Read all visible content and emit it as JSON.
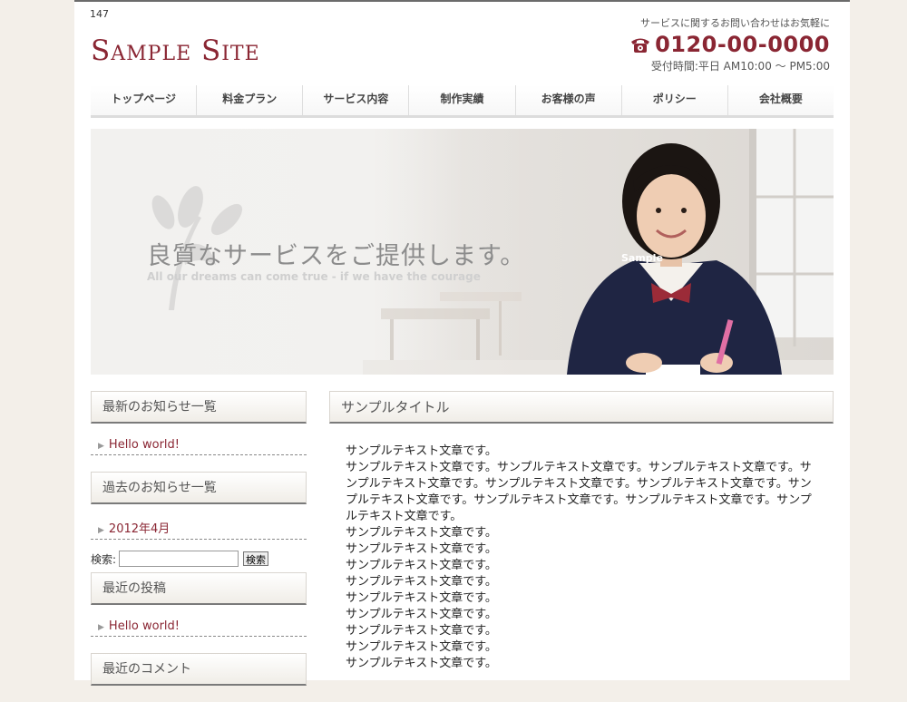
{
  "page_id": "147",
  "site": {
    "logo": "Sample Site"
  },
  "contact": {
    "note": "サービスに関するお問い合わせはお気軽に",
    "phone": "0120-00-0000",
    "hours": "受付時間:平日 AM10:00 〜 PM5:00",
    "icon": "phone-icon"
  },
  "nav": {
    "items": [
      "トップページ",
      "料金プラン",
      "サービス内容",
      "制作実績",
      "お客様の声",
      "ポリシー",
      "会社概要"
    ]
  },
  "hero": {
    "headline": "良質なサービスをご提供します。",
    "subline": "All our dreams can come true - if we have the courage",
    "watermark": "Sample"
  },
  "sidebar": {
    "news_title": "最新のお知らせ一覧",
    "news_items": [
      "Hello world!"
    ],
    "archive_title": "過去のお知らせ一覧",
    "archive_items": [
      "2012年4月"
    ],
    "search_label": "検索:",
    "search_value": "",
    "search_button": "検索",
    "recent_posts_title": "最近の投稿",
    "recent_posts": [
      "Hello world!"
    ],
    "recent_comments_title": "最近のコメント"
  },
  "main": {
    "title": "サンプルタイトル",
    "lines": [
      "サンプルテキスト文章です。",
      "サンプルテキスト文章です。サンプルテキスト文章です。サンプルテキスト文章です。サ",
      "ンプルテキスト文章です。サンプルテキスト文章です。サンプルテキスト文章です。サン",
      "プルテキスト文章です。サンプルテキスト文章です。サンプルテキスト文章です。サンプ",
      "ルテキスト文章です。",
      "サンプルテキスト文章です。",
      "サンプルテキスト文章です。",
      "サンプルテキスト文章です。",
      "サンプルテキスト文章です。",
      "サンプルテキスト文章です。",
      "サンプルテキスト文章です。",
      "サンプルテキスト文章です。",
      "サンプルテキスト文章です。",
      "サンプルテキスト文章です。"
    ]
  },
  "colors": {
    "accent": "#8a2633",
    "background": "#f3efe9"
  }
}
